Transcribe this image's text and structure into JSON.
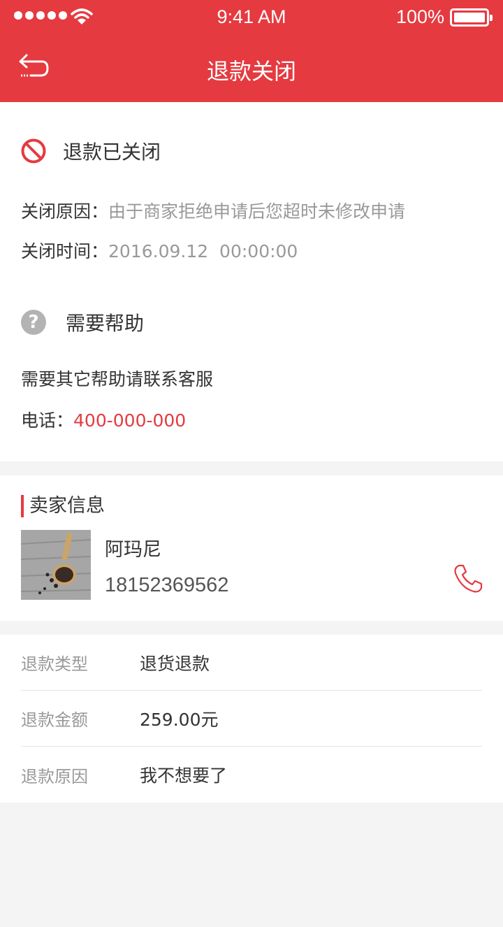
{
  "status_bar": {
    "time": "9:41 AM",
    "battery": "100%"
  },
  "nav": {
    "title": "退款关闭"
  },
  "refund_status": {
    "title": "退款已关闭",
    "reason_label": "关闭原因：",
    "reason_value": "由于商家拒绝申请后您超时未修改申请",
    "time_label": "关闭时间：",
    "time_value": "2016.09.12  00:00:00"
  },
  "help": {
    "icon_text": "?",
    "title": "需要帮助",
    "description": "需要其它帮助请联系客服",
    "phone_label": "电话：",
    "phone_value": "400-000-000"
  },
  "seller": {
    "section_title": "卖家信息",
    "name": "阿玛尼",
    "phone": "18152369562"
  },
  "details": [
    {
      "label": "退款类型",
      "value": "退货退款"
    },
    {
      "label": "退款金额",
      "value": "259.00元"
    },
    {
      "label": "退款原因",
      "value": "我不想要了"
    }
  ],
  "colors": {
    "accent": "#e53a40",
    "background": "#f4f4f4",
    "muted_text": "#999999"
  },
  "icons": [
    "signal-icon",
    "wifi-icon",
    "battery-icon",
    "back-icon",
    "prohibited-icon",
    "help-icon",
    "phone-icon"
  ]
}
